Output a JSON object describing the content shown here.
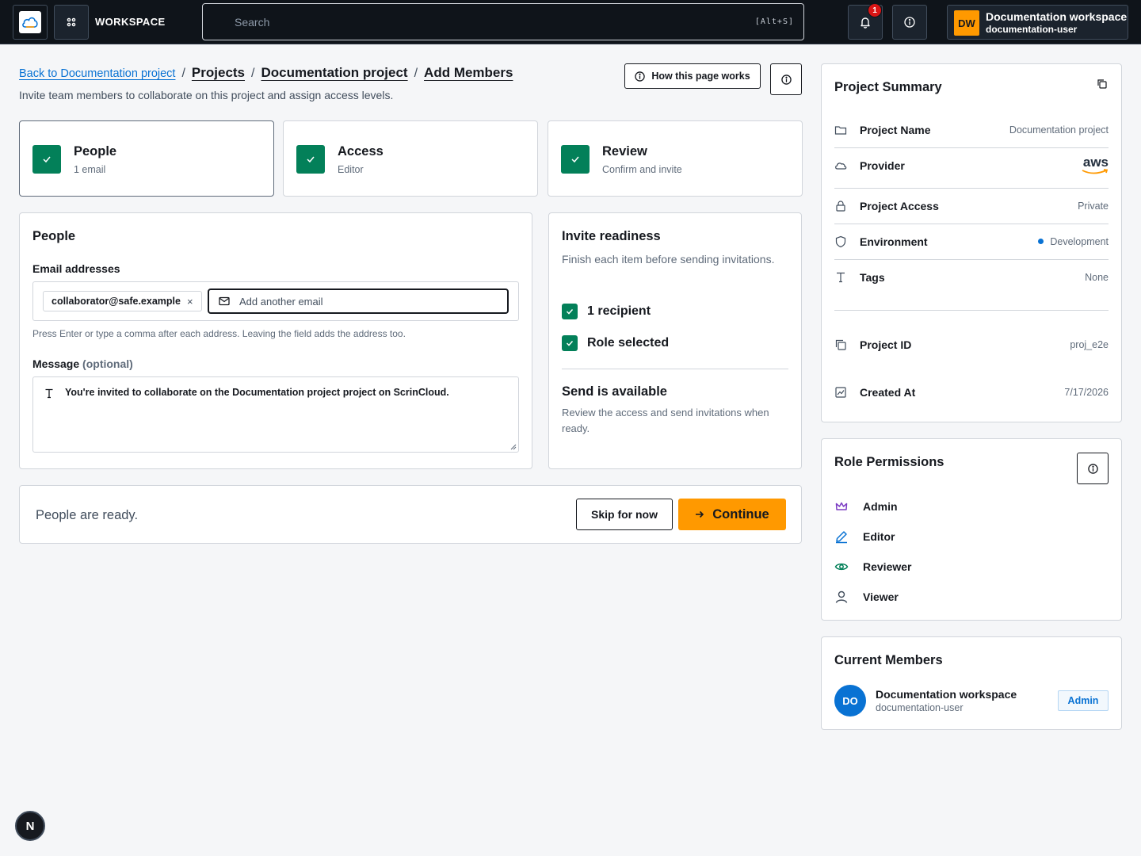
{
  "topbar": {
    "workspace_label": "WORKSPACE",
    "search_placeholder": "Search",
    "search_shortcut": "[Alt+S]",
    "notification_count": "1",
    "user_name": "Documentation workspace",
    "user_login": "documentation-user",
    "user_initials": "DW"
  },
  "header": {
    "back_link": "Back to Documentation project",
    "breadcrumbs": [
      "Projects",
      "Documentation project",
      "Add Members"
    ],
    "separator": "/",
    "subtitle": "Invite team members to collaborate on this project and assign access levels.",
    "how_button": "How this page works"
  },
  "steps": [
    {
      "title": "People",
      "sub": "1 email"
    },
    {
      "title": "Access",
      "sub": "Editor"
    },
    {
      "title": "Review",
      "sub": "Confirm and invite"
    }
  ],
  "people": {
    "title": "People",
    "email_label": "Email addresses",
    "chip": "collaborator@safe.example",
    "chip_remove": "×",
    "add_placeholder": "Add another email",
    "hint": "Press Enter or type a comma after each address. Leaving the field adds the address too.",
    "message_label": "Message",
    "message_optional": "(optional)",
    "message_value": "You're invited to collaborate on the Documentation project project on ScrinCloud."
  },
  "readiness": {
    "title": "Invite readiness",
    "subtitle": "Finish each item before sending invitations.",
    "items": [
      "1 recipient",
      "Role selected"
    ],
    "send_title": "Send is available",
    "send_sub": "Review the access and send invitations when ready."
  },
  "footer": {
    "status": "People are ready.",
    "skip": "Skip for now",
    "continue": "Continue"
  },
  "summary": {
    "title": "Project Summary",
    "rows": [
      {
        "label": "Project Name",
        "value": "Documentation project"
      },
      {
        "label": "Provider",
        "value": "aws"
      },
      {
        "label": "Project Access",
        "value": "Private"
      },
      {
        "label": "Environment",
        "value": "Development"
      },
      {
        "label": "Tags",
        "value": "None"
      },
      {
        "label": "Project ID",
        "value": "proj_e2e"
      },
      {
        "label": "Created At",
        "value": "7/17/2026"
      }
    ]
  },
  "roles": {
    "title": "Role Permissions",
    "items": [
      "Admin",
      "Editor",
      "Reviewer",
      "Viewer"
    ]
  },
  "members": {
    "title": "Current Members",
    "list": [
      {
        "initials": "DO",
        "name": "Documentation workspace",
        "login": "documentation-user",
        "role": "Admin"
      }
    ]
  },
  "dev_badge": "N",
  "colors": {
    "accent": "#ff9900",
    "success": "#038059",
    "link": "#0972d3",
    "topbar": "#0f141a"
  }
}
